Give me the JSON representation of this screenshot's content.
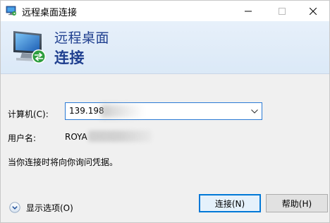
{
  "window": {
    "title": "远程桌面连接"
  },
  "banner": {
    "line1": "远程桌面",
    "line2": "连接"
  },
  "form": {
    "computer_label": "计算机(C):",
    "computer_value": "139.198",
    "user_label": "用户名:",
    "user_value": "ROYA",
    "hint": "当你连接时将向你询问凭据。"
  },
  "footer": {
    "show_options": "显示选项(O)",
    "connect_label": "连接(N)",
    "help_label": "帮助(H)"
  },
  "icons": {
    "app": "remote-desktop-icon",
    "banner": "remote-desktop-monitor-icon",
    "minimize": "minimize-icon",
    "maximize": "maximize-icon",
    "close": "close-icon",
    "dropdown": "chevron-down-icon",
    "expand": "expand-circle-icon"
  },
  "colors": {
    "accent": "#0078d7",
    "banner_title": "#1f3f8f",
    "banner_bg": "#dbe9f7"
  }
}
